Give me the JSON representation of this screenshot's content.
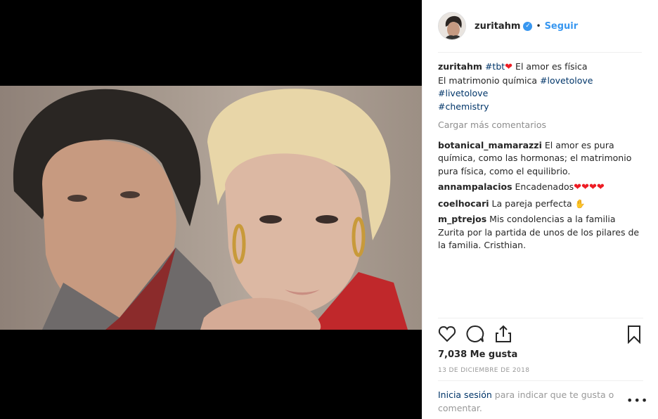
{
  "header": {
    "username": "zuritahm",
    "separator": "•",
    "follow_label": "Seguir"
  },
  "caption": {
    "username": "zuritahm",
    "tag1": "#tbt",
    "text1": " El amor es física",
    "text2": "El matrimonio química ",
    "tag2": "#lovetolove",
    "tag3": "#livetolove",
    "tag4": "#chemistry"
  },
  "load_more": "Cargar más comentarios",
  "comments": [
    {
      "user": "botanical_mamarazzi",
      "text": "El amor es pura química, como las hormonas; el matrimonio pura física, como el equilibrio."
    },
    {
      "user": "annampalacios",
      "text": "Encadenados"
    },
    {
      "user": "coelhocari",
      "text": "La pareja perfecta"
    },
    {
      "user": "m_ptrejos",
      "text": "Mis condolencias a la familia Zurita por la partida de unos de los pilares de la familia. Cristhian."
    }
  ],
  "likes": "7,038 Me gusta",
  "date": "13 DE DICIEMBRE DE 2018",
  "login": {
    "link": "Inicia sesión",
    "text": " para indicar que te gusta o comentar."
  },
  "more_label": "•••",
  "colors": {
    "link": "#3897f0",
    "tag": "#003569",
    "muted": "#8e8e8e",
    "heart": "#ed1c24"
  }
}
